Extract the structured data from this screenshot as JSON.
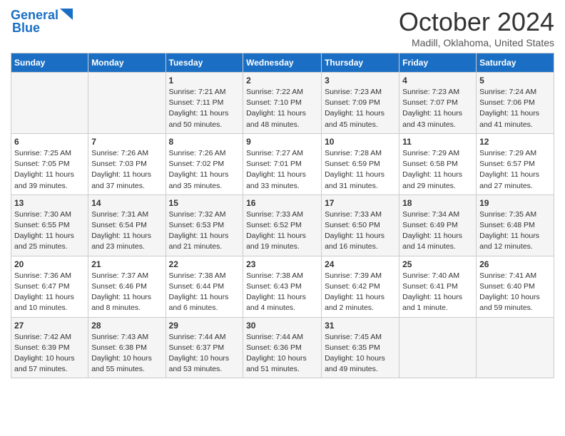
{
  "header": {
    "logo_line1": "General",
    "logo_line2": "Blue",
    "month_title": "October 2024",
    "location": "Madill, Oklahoma, United States"
  },
  "days_of_week": [
    "Sunday",
    "Monday",
    "Tuesday",
    "Wednesday",
    "Thursday",
    "Friday",
    "Saturday"
  ],
  "weeks": [
    [
      {
        "day": "",
        "content": ""
      },
      {
        "day": "",
        "content": ""
      },
      {
        "day": "1",
        "content": "Sunrise: 7:21 AM\nSunset: 7:11 PM\nDaylight: 11 hours and 50 minutes."
      },
      {
        "day": "2",
        "content": "Sunrise: 7:22 AM\nSunset: 7:10 PM\nDaylight: 11 hours and 48 minutes."
      },
      {
        "day": "3",
        "content": "Sunrise: 7:23 AM\nSunset: 7:09 PM\nDaylight: 11 hours and 45 minutes."
      },
      {
        "day": "4",
        "content": "Sunrise: 7:23 AM\nSunset: 7:07 PM\nDaylight: 11 hours and 43 minutes."
      },
      {
        "day": "5",
        "content": "Sunrise: 7:24 AM\nSunset: 7:06 PM\nDaylight: 11 hours and 41 minutes."
      }
    ],
    [
      {
        "day": "6",
        "content": "Sunrise: 7:25 AM\nSunset: 7:05 PM\nDaylight: 11 hours and 39 minutes."
      },
      {
        "day": "7",
        "content": "Sunrise: 7:26 AM\nSunset: 7:03 PM\nDaylight: 11 hours and 37 minutes."
      },
      {
        "day": "8",
        "content": "Sunrise: 7:26 AM\nSunset: 7:02 PM\nDaylight: 11 hours and 35 minutes."
      },
      {
        "day": "9",
        "content": "Sunrise: 7:27 AM\nSunset: 7:01 PM\nDaylight: 11 hours and 33 minutes."
      },
      {
        "day": "10",
        "content": "Sunrise: 7:28 AM\nSunset: 6:59 PM\nDaylight: 11 hours and 31 minutes."
      },
      {
        "day": "11",
        "content": "Sunrise: 7:29 AM\nSunset: 6:58 PM\nDaylight: 11 hours and 29 minutes."
      },
      {
        "day": "12",
        "content": "Sunrise: 7:29 AM\nSunset: 6:57 PM\nDaylight: 11 hours and 27 minutes."
      }
    ],
    [
      {
        "day": "13",
        "content": "Sunrise: 7:30 AM\nSunset: 6:55 PM\nDaylight: 11 hours and 25 minutes."
      },
      {
        "day": "14",
        "content": "Sunrise: 7:31 AM\nSunset: 6:54 PM\nDaylight: 11 hours and 23 minutes."
      },
      {
        "day": "15",
        "content": "Sunrise: 7:32 AM\nSunset: 6:53 PM\nDaylight: 11 hours and 21 minutes."
      },
      {
        "day": "16",
        "content": "Sunrise: 7:33 AM\nSunset: 6:52 PM\nDaylight: 11 hours and 19 minutes."
      },
      {
        "day": "17",
        "content": "Sunrise: 7:33 AM\nSunset: 6:50 PM\nDaylight: 11 hours and 16 minutes."
      },
      {
        "day": "18",
        "content": "Sunrise: 7:34 AM\nSunset: 6:49 PM\nDaylight: 11 hours and 14 minutes."
      },
      {
        "day": "19",
        "content": "Sunrise: 7:35 AM\nSunset: 6:48 PM\nDaylight: 11 hours and 12 minutes."
      }
    ],
    [
      {
        "day": "20",
        "content": "Sunrise: 7:36 AM\nSunset: 6:47 PM\nDaylight: 11 hours and 10 minutes."
      },
      {
        "day": "21",
        "content": "Sunrise: 7:37 AM\nSunset: 6:46 PM\nDaylight: 11 hours and 8 minutes."
      },
      {
        "day": "22",
        "content": "Sunrise: 7:38 AM\nSunset: 6:44 PM\nDaylight: 11 hours and 6 minutes."
      },
      {
        "day": "23",
        "content": "Sunrise: 7:38 AM\nSunset: 6:43 PM\nDaylight: 11 hours and 4 minutes."
      },
      {
        "day": "24",
        "content": "Sunrise: 7:39 AM\nSunset: 6:42 PM\nDaylight: 11 hours and 2 minutes."
      },
      {
        "day": "25",
        "content": "Sunrise: 7:40 AM\nSunset: 6:41 PM\nDaylight: 11 hours and 1 minute."
      },
      {
        "day": "26",
        "content": "Sunrise: 7:41 AM\nSunset: 6:40 PM\nDaylight: 10 hours and 59 minutes."
      }
    ],
    [
      {
        "day": "27",
        "content": "Sunrise: 7:42 AM\nSunset: 6:39 PM\nDaylight: 10 hours and 57 minutes."
      },
      {
        "day": "28",
        "content": "Sunrise: 7:43 AM\nSunset: 6:38 PM\nDaylight: 10 hours and 55 minutes."
      },
      {
        "day": "29",
        "content": "Sunrise: 7:44 AM\nSunset: 6:37 PM\nDaylight: 10 hours and 53 minutes."
      },
      {
        "day": "30",
        "content": "Sunrise: 7:44 AM\nSunset: 6:36 PM\nDaylight: 10 hours and 51 minutes."
      },
      {
        "day": "31",
        "content": "Sunrise: 7:45 AM\nSunset: 6:35 PM\nDaylight: 10 hours and 49 minutes."
      },
      {
        "day": "",
        "content": ""
      },
      {
        "day": "",
        "content": ""
      }
    ]
  ]
}
